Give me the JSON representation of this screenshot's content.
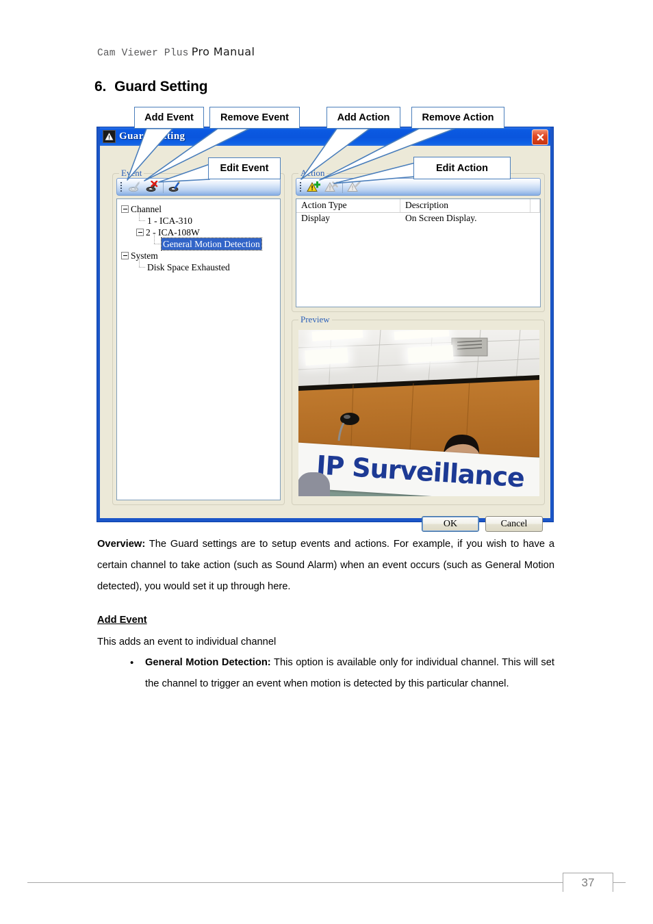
{
  "header": {
    "product": "Cam Viewer Plus",
    "manual": "Pro Manual"
  },
  "section": {
    "number": "6.",
    "title": "Guard Setting"
  },
  "callouts": {
    "add_event": "Add Event",
    "remove_event": "Remove Event",
    "add_action": "Add Action",
    "remove_action": "Remove Action",
    "edit_event": "Edit Event",
    "edit_action": "Edit Action"
  },
  "dialog": {
    "title": "Guard Setting",
    "title_icon": "warning-triangle-icon",
    "close_icon": "close-icon",
    "event_group": {
      "label": "Event",
      "toolbar": [
        {
          "name": "add-event-icon",
          "state": "disabled"
        },
        {
          "name": "remove-event-icon",
          "state": "enabled"
        },
        {
          "name": "edit-event-icon",
          "state": "enabled"
        }
      ],
      "tree": [
        {
          "label": "Channel",
          "level": 0,
          "expander": "minus",
          "selected": false
        },
        {
          "label": "1 - ICA-310",
          "level": 1,
          "expander": "none",
          "selected": false
        },
        {
          "label": "2 - ICA-108W",
          "level": 1,
          "expander": "minus",
          "selected": false
        },
        {
          "label": "General Motion Detection",
          "level": 2,
          "expander": "none",
          "selected": true
        },
        {
          "label": "System",
          "level": 0,
          "expander": "minus",
          "selected": false
        },
        {
          "label": "Disk Space Exhausted",
          "level": 1,
          "expander": "none",
          "selected": false
        }
      ]
    },
    "action_group": {
      "label": "Action",
      "toolbar": [
        {
          "name": "add-action-icon",
          "state": "enabled"
        },
        {
          "name": "remove-action-icon",
          "state": "disabled"
        },
        {
          "name": "edit-action-icon",
          "state": "disabled"
        }
      ],
      "columns": [
        "Action Type",
        "Description"
      ],
      "rows": [
        {
          "type": "Display",
          "description": "On Screen Display."
        }
      ]
    },
    "preview_group": {
      "label": "Preview",
      "image_caption": "IP Surveillance"
    },
    "buttons": {
      "ok": "OK",
      "cancel": "Cancel"
    }
  },
  "body": {
    "overview_label": "Overview:",
    "overview_text": " The Guard settings are to setup events and actions. For example, if you wish to have a certain channel to take action (such as Sound Alarm) when an event occurs (such as General Motion detected), you would set it up through here.",
    "add_event_heading": "Add Event",
    "add_event_line": "This adds an event to individual channel",
    "bullets": [
      {
        "term": "General Motion Detection:",
        "text": " This option is available only for individual channel. This will set the channel to trigger an event when motion is detected by this particular channel."
      }
    ]
  },
  "footer": {
    "page_number": "37"
  },
  "colors": {
    "titlebar_blue": "#0a55dd",
    "callout_border": "#4a7ebb",
    "selection_blue": "#3164c8",
    "group_label_blue": "#2b5fb8",
    "dialog_face": "#ece9d8"
  }
}
